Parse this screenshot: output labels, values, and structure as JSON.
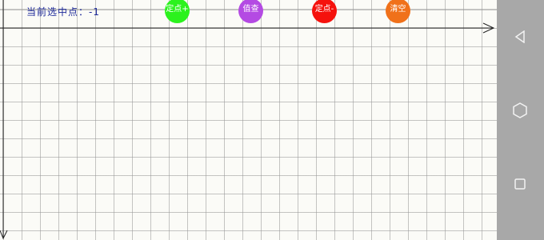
{
  "status": {
    "label": "当前选中点：",
    "value": "-1"
  },
  "buttons": {
    "add": "定点+",
    "query": "值查",
    "remove": "定点-",
    "clear": "清空"
  },
  "colors": {
    "add": "#2bf21d",
    "query": "#b44ae3",
    "remove": "#f5120d",
    "clear": "#f0711a",
    "status_text": "#1e2a9a",
    "navbar": "#a8a8a8"
  },
  "icons": {
    "back": "triangle-back-icon",
    "home": "hexagon-home-icon",
    "recent": "square-recent-icon"
  }
}
